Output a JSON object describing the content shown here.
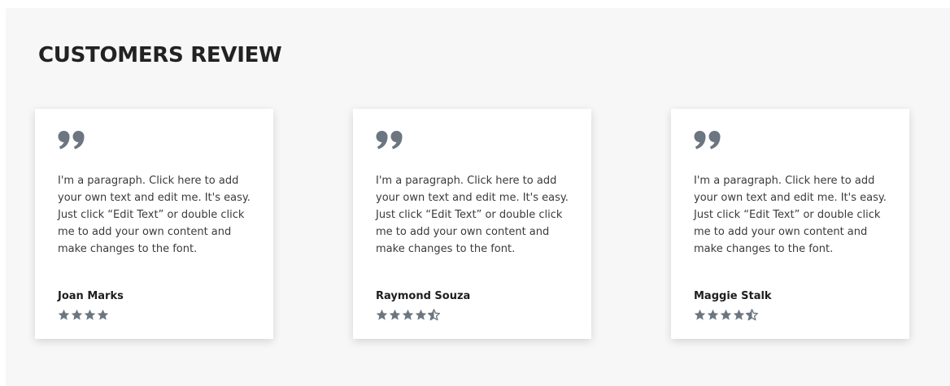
{
  "section": {
    "title": "CUSTOMERS REVIEW"
  },
  "colors": {
    "icon": "#6b7680",
    "background": "#f7f7f8",
    "card": "#ffffff"
  },
  "reviews": [
    {
      "text": "I'm a paragraph. Click here to add your own text and edit me. It's easy. Just click “Edit Text” or double click me to add your own content and make changes to the font.",
      "author": "Joan Marks",
      "rating": 4,
      "icon": "quote-icon"
    },
    {
      "text": "I'm a paragraph. Click here to add your own text and edit me. It's easy. Just click “Edit Text” or double click me to add your own content and make changes to the font.",
      "author": "Raymond Souza",
      "rating": 4.5,
      "icon": "quote-icon"
    },
    {
      "text": "I'm a paragraph. Click here to add your own text and edit me. It's easy. Just click “Edit Text” or double click me to add your own content and make changes to the font.",
      "author": "Maggie Stalk",
      "rating": 4.5,
      "icon": "quote-icon"
    }
  ]
}
